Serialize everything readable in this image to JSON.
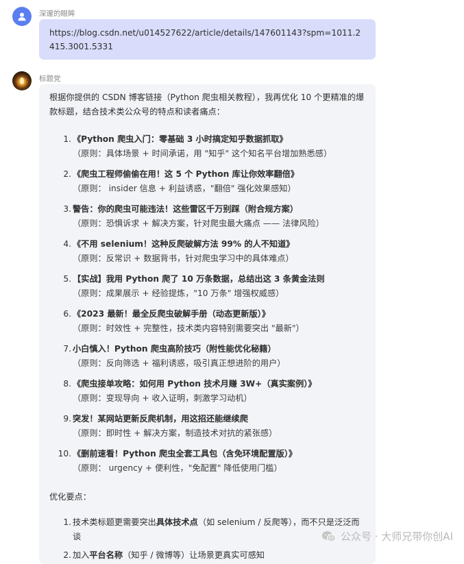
{
  "user": {
    "name": "深邃的眼眸",
    "message": "https://blog.csdn.net/u014527622/article/details/147601143?spm=1011.2415.3001.5331"
  },
  "bot": {
    "name": "标题党",
    "intro": "根据你提供的 CSDN 博客链接（Python 爬虫相关教程），我再优化 10 个更精准的爆款标题，结合技术类公众号的特点和读者痛点：",
    "titles": [
      {
        "num": "1.",
        "title": "《Python 爬虫入门：零基础 3 小时搞定知乎数据抓取》",
        "reason": "（原则：具体场景 + 时间承诺，用 \"知乎\" 这个知名平台增加熟悉感）"
      },
      {
        "num": "2.",
        "title": "《爬虫工程师偷偷在用！这 5 个 Python 库让你效率翻倍》",
        "reason": "（原则： insider 信息 + 利益诱惑，\"翻倍\" 强化效果感知）"
      },
      {
        "num": "3.",
        "title": "警告：你的爬虫可能违法！这些雷区千万别踩（附合规方案）",
        "reason": "（原则：恐惧诉求 + 解决方案，针对爬虫最大痛点 —— 法律风险）"
      },
      {
        "num": "4.",
        "title": "《不用 selenium！这种反爬破解方法 99% 的人不知道》",
        "reason": "（原则：反常识 + 数据背书，针对爬虫学习中的具体难点）"
      },
      {
        "num": "5.",
        "title": "【实战】我用 Python 爬了 10 万条数据，总结出这 3 条黄金法则",
        "reason": "（原则：成果展示 + 经验提炼，\"10 万条\" 增强权威感）"
      },
      {
        "num": "6.",
        "title": "《2023 最新！最全反爬虫破解手册（动态更新版）》",
        "reason": "（原则：时效性 + 完整性，技术类内容特别需要突出 \"最新\"）"
      },
      {
        "num": "7.",
        "title": "小白慎入！Python 爬虫高阶技巧（附性能优化秘籍）",
        "reason": "（原则：反向筛选 + 福利诱惑，吸引真正想进阶的用户）"
      },
      {
        "num": "8.",
        "title": "《爬虫接单攻略：如何用 Python 技术月赚 3W+（真实案例）》",
        "reason": "（原则：变现导向 + 收入证明，刺激学习动机）"
      },
      {
        "num": "9.",
        "title": "突发！某网站更新反爬机制，用这招还能继续爬",
        "reason": "（原则：即时性 + 解决方案，制造技术对抗的紧张感）"
      },
      {
        "num": "10.",
        "title": "《删前速看！Python 爬虫全套工具包（含免环境配置版）》",
        "reason": "（原则： urgency + 便利性，\"免配置\" 降低使用门槛）"
      }
    ],
    "optimization_heading": "优化要点：",
    "points": [
      {
        "num": "1.",
        "pre": "技术类标题更需要突出",
        "bold": "具体技术点",
        "post": "（如 selenium / 反爬等），而不只是泛泛而谈"
      },
      {
        "num": "2.",
        "pre": "加入",
        "bold": "平台名称",
        "post": "（知乎 / 微博等）让场景更真实可感知"
      }
    ]
  },
  "watermark": {
    "text": "公众号 · 大师兄带你创AI",
    "icon": "wechat-icon"
  },
  "colors": {
    "user_bubble": "#d9dcfb",
    "bot_bubble": "#f3f4f7",
    "user_avatar": "#5b7ef0"
  }
}
